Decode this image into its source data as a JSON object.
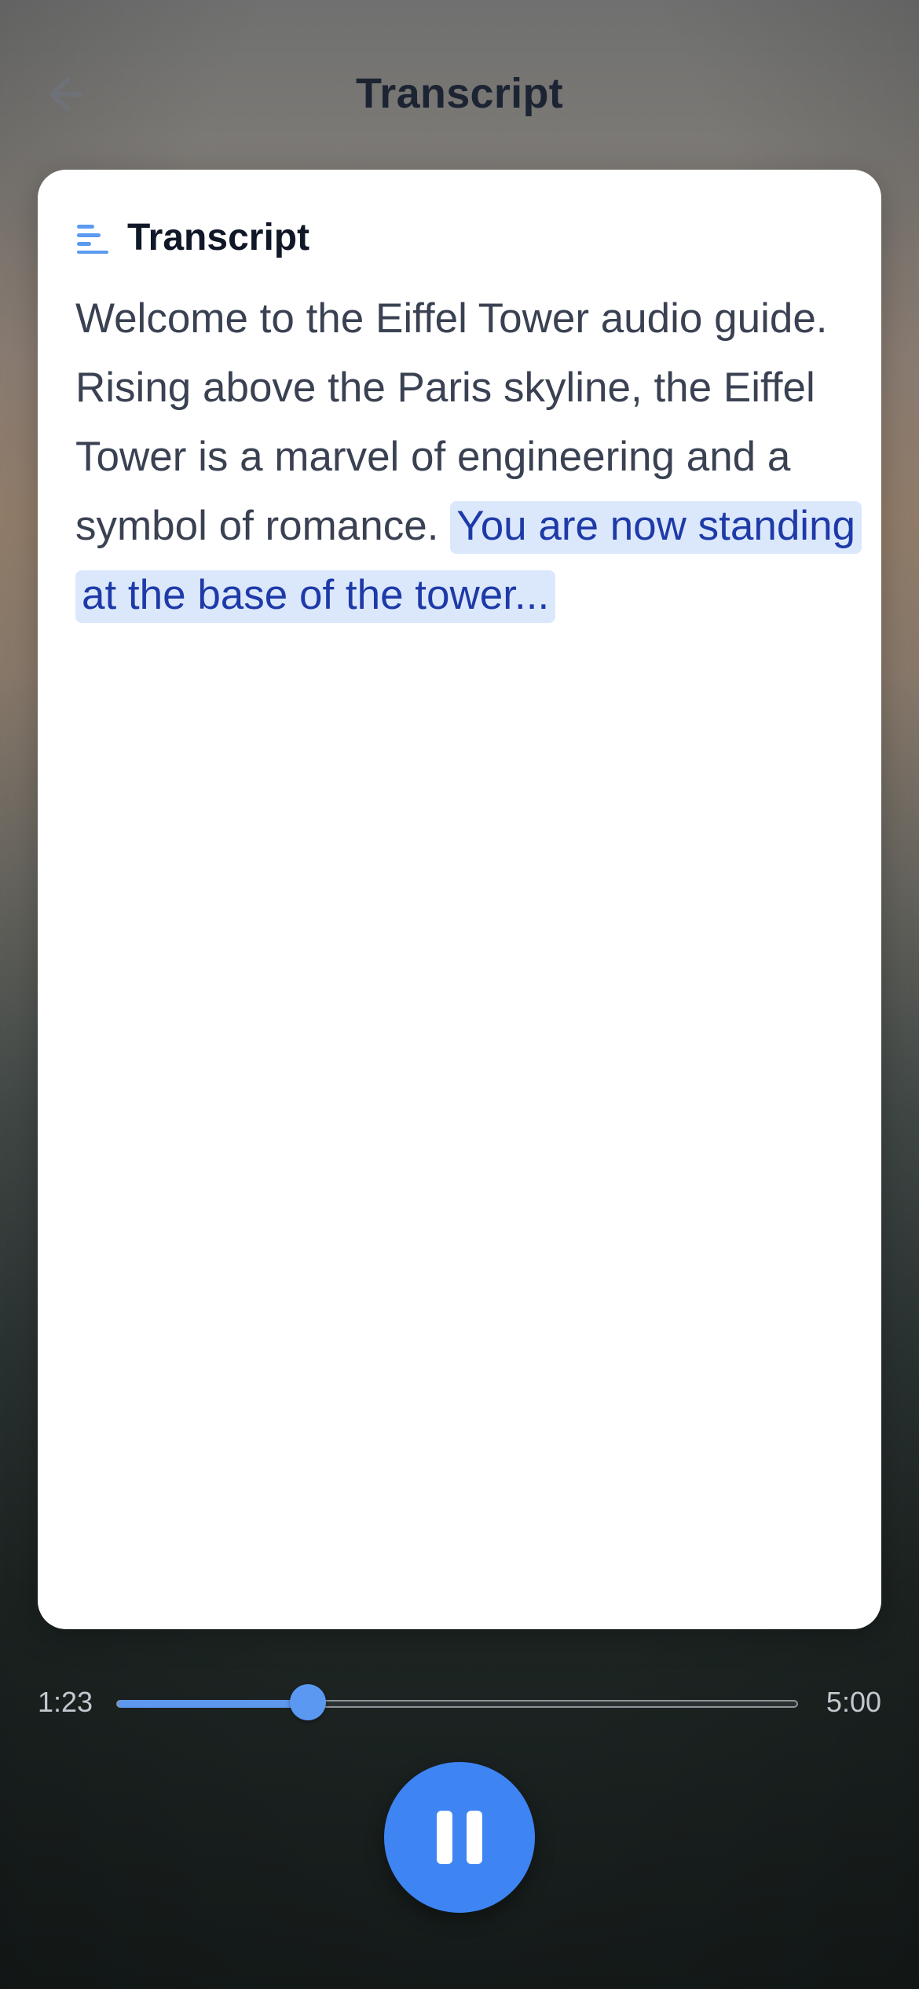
{
  "header": {
    "title": "Transcript",
    "back_icon": "arrow-left-icon"
  },
  "card": {
    "icon": "list-icon",
    "title": "Transcript",
    "transcript_played": "Welcome to the Eiffel Tower audio guide. Rising above the Paris skyline, the Eiffel Tower is a marvel of engineering and a symbol of romance.",
    "transcript_current": "You are now standing at the base of the tower..."
  },
  "player": {
    "elapsed": "1:23",
    "total": "5:00",
    "progress_fraction": 0.28,
    "pause_icon": "pause-icon"
  },
  "colors": {
    "accent": "#3e84f3",
    "highlight_bg": "#dbe8fc",
    "highlight_text": "#1e3aa8",
    "title_text": "#101828",
    "body_text": "#394152"
  }
}
